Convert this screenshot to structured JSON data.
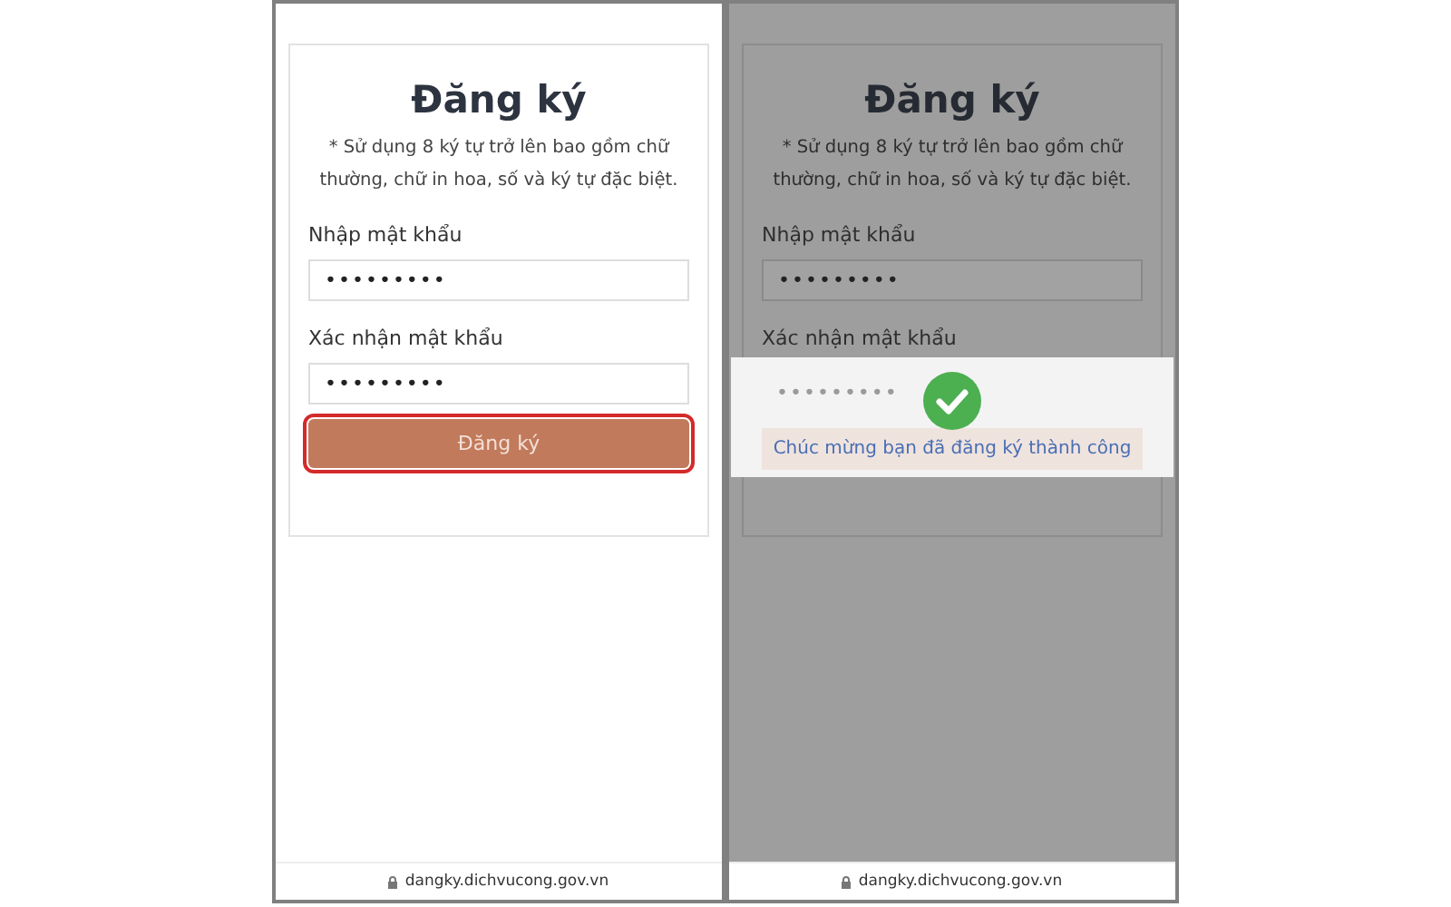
{
  "screens": [
    {
      "dimmed": false,
      "title": "Đăng ký",
      "hint": "* Sử dụng 8 ký tự trở lên bao gồm chữ thường, chữ in hoa, số và ký tự đặc biệt.",
      "fields": [
        {
          "label": "Nhập mật khẩu",
          "value": "•••••••••"
        },
        {
          "label": "Xác nhận mật khẩu",
          "value": "•••••••••"
        }
      ],
      "button": {
        "label": "Đăng ký",
        "highlighted": true
      },
      "url": "dangky.dichvucong.gov.vn"
    },
    {
      "dimmed": true,
      "title": "Đăng ký",
      "hint": "* Sử dụng 8 ký tự trở lên bao gồm chữ thường, chữ in hoa, số và ký tự đặc biệt.",
      "fields": [
        {
          "label": "Nhập mật khẩu",
          "value": "•••••••••"
        },
        {
          "label": "Xác nhận mật khẩu"
        }
      ],
      "toast": {
        "value": "•••••••••",
        "message": "Chúc mừng bạn đã đăng ký thành công"
      },
      "url": "dangky.dichvucong.gov.vn"
    }
  ]
}
